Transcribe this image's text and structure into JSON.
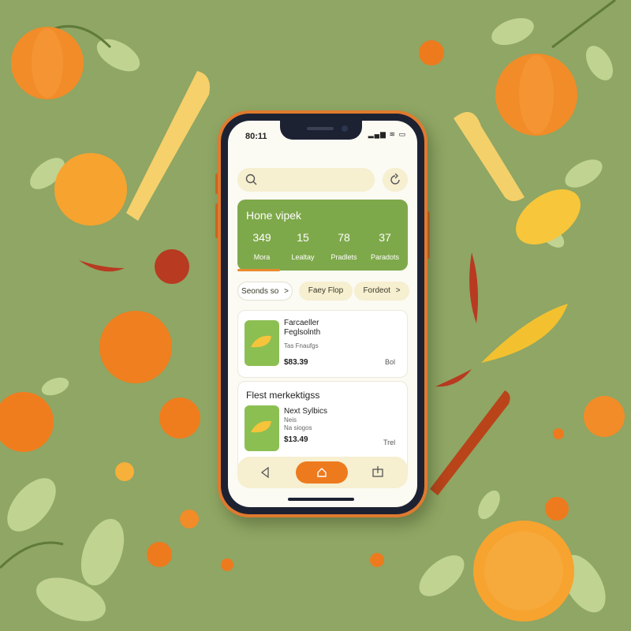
{
  "status_bar": {
    "time": "80:11",
    "icons": "▂▄▆ ≋ ▭"
  },
  "search": {
    "placeholder": ""
  },
  "hero": {
    "title": "Hone vipek",
    "stats": [
      {
        "value": "349",
        "label": "Mora"
      },
      {
        "value": "15",
        "label": "Lealtay"
      },
      {
        "value": "78",
        "label": "Pradlets"
      },
      {
        "value": "37",
        "label": "Paradots"
      }
    ]
  },
  "chips": [
    "Seonds so",
    "Faey Flop",
    "Fordeot"
  ],
  "chip_arrow": ">",
  "products": [
    {
      "title_line1": "Farcaeller",
      "title_line2": "Feglsolnth",
      "subtitle": "Tas Fnaufgs",
      "price": "$83.39",
      "tag": "Bol"
    },
    {
      "title_line1": "Next Sylbics",
      "title_line2": "Neis",
      "subtitle": "Na siogos",
      "price": "$13.49",
      "tag": "Trel"
    }
  ],
  "section": {
    "title": "Flest merkektigss"
  },
  "colors": {
    "background": "#8fa664",
    "phone_frame": "#e07a2e",
    "hero_green": "#7ea94a",
    "accent_orange": "#ee7a1e",
    "chip_cream": "#f6efd0"
  },
  "icons": {
    "search": "search-icon",
    "refresh": "refresh-icon",
    "back": "back-arrow-icon",
    "home": "home-icon",
    "share": "share-icon",
    "product": "mango-icon"
  }
}
